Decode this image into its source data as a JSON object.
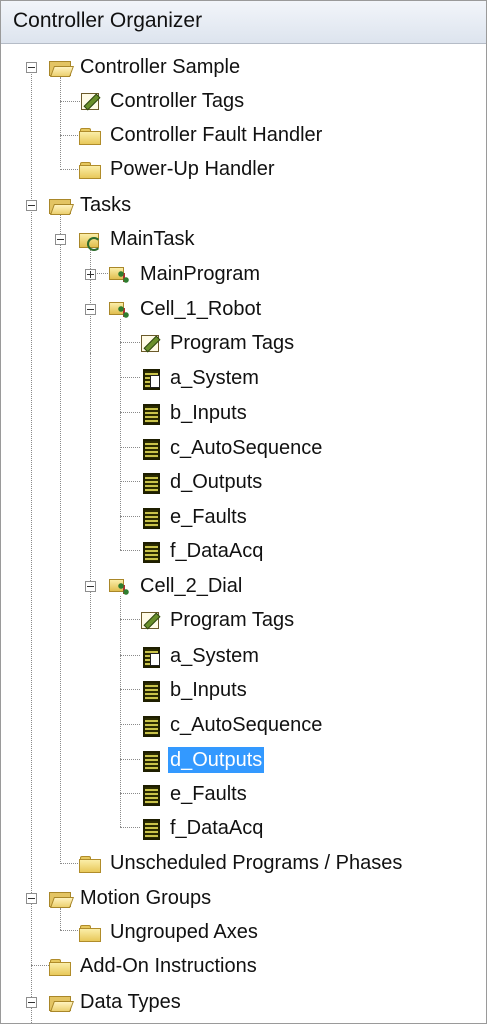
{
  "window": {
    "title": "Controller Organizer"
  },
  "tree": {
    "controller": "Controller Sample",
    "controller_tags": "Controller Tags",
    "controller_fault_handler": "Controller Fault Handler",
    "power_up_handler": "Power-Up Handler",
    "tasks": "Tasks",
    "main_task": "MainTask",
    "main_program": "MainProgram",
    "program1": {
      "name": "Cell_1_Robot",
      "items": [
        "Program Tags",
        "a_System",
        "b_Inputs",
        "c_AutoSequence",
        "d_Outputs",
        "e_Faults",
        "f_DataAcq"
      ]
    },
    "program2": {
      "name": "Cell_2_Dial",
      "items": [
        "Program Tags",
        "a_System",
        "b_Inputs",
        "c_AutoSequence",
        "d_Outputs",
        "e_Faults",
        "f_DataAcq"
      ],
      "selected": "d_Outputs"
    },
    "unscheduled": "Unscheduled Programs / Phases",
    "motion_groups": "Motion Groups",
    "ungrouped_axes": "Ungrouped Axes",
    "add_on_instructions": "Add-On Instructions",
    "data_types": "Data Types"
  }
}
